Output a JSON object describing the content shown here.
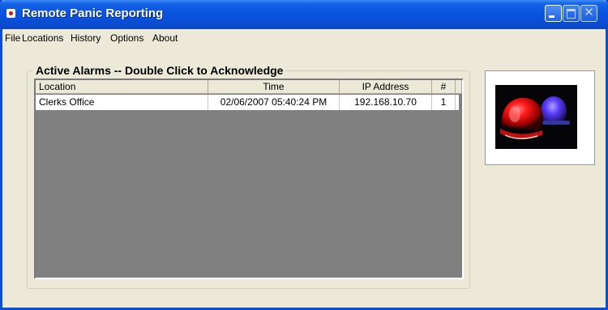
{
  "window": {
    "title": "Remote Panic Reporting",
    "accent_color": "#0a4fd4",
    "buttons": {
      "minimize_icon": "minimize-icon",
      "maximize_icon": "maximize-icon",
      "close_icon": "close-icon",
      "close_glyph": "✕"
    }
  },
  "menu": {
    "items": [
      {
        "label": "File"
      },
      {
        "label": "Locations"
      },
      {
        "label": "History"
      },
      {
        "label": "Options"
      },
      {
        "label": "About"
      }
    ]
  },
  "alarms": {
    "group_label": "Active Alarms -- Double Click to Acknowledge",
    "columns": [
      {
        "label": "Location"
      },
      {
        "label": "Time"
      },
      {
        "label": "IP Address"
      },
      {
        "label": "#"
      }
    ],
    "rows": [
      {
        "location": "Clerks Office",
        "time": "02/06/2007 05:40:24 PM",
        "ip": "192.168.10.70",
        "count": "1"
      }
    ]
  },
  "image": {
    "icon": "siren-lights-icon",
    "colors": {
      "red": "#e01010",
      "blue": "#5a3cff"
    }
  }
}
